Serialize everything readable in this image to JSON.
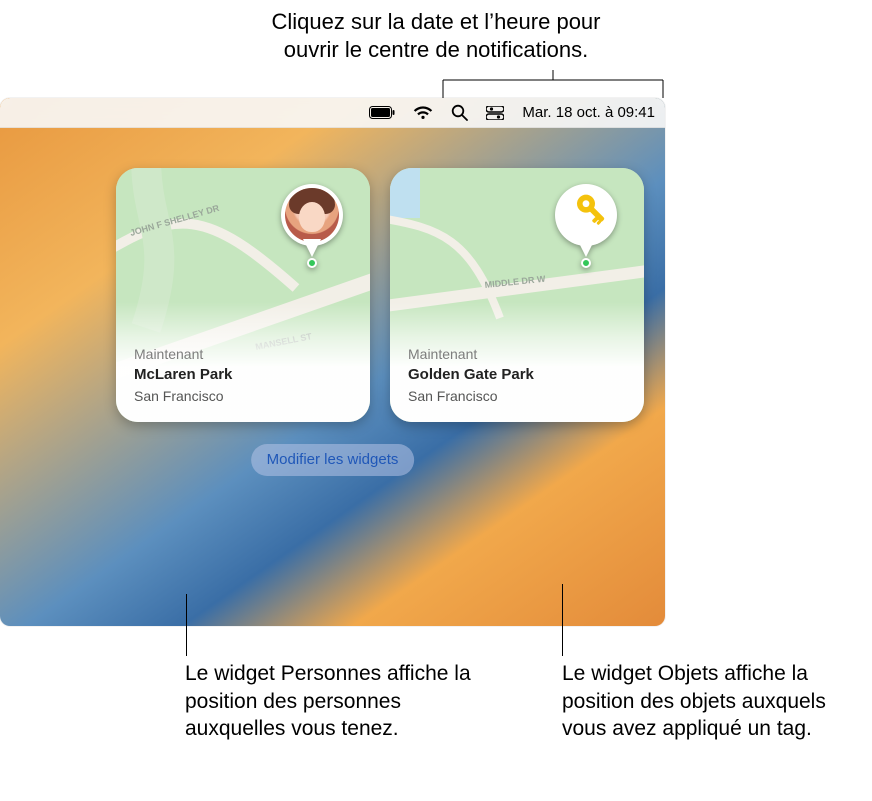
{
  "callouts": {
    "top_line1": "Cliquez sur la date et l’heure pour",
    "top_line2": "ouvrir le centre de notifications.",
    "bottom_left": "Le widget Personnes affiche la position des personnes auxquelles vous tenez.",
    "bottom_right": "Le widget Objets affiche la position des objets auxquels vous avez appliqué un tag."
  },
  "menubar": {
    "datetime": "Mar. 18 oct. à 09:41"
  },
  "widgets": {
    "people": {
      "now_label": "Maintenant",
      "place": "McLaren Park",
      "city": "San Francisco",
      "roads": {
        "r1": "JOHN F SHELLEY DR",
        "r2": "MANSELL ST"
      }
    },
    "items": {
      "now_label": "Maintenant",
      "place": "Golden Gate Park",
      "city": "San Francisco",
      "roads": {
        "r1": "MIDDLE DR W"
      }
    },
    "edit_button": "Modifier les widgets"
  }
}
